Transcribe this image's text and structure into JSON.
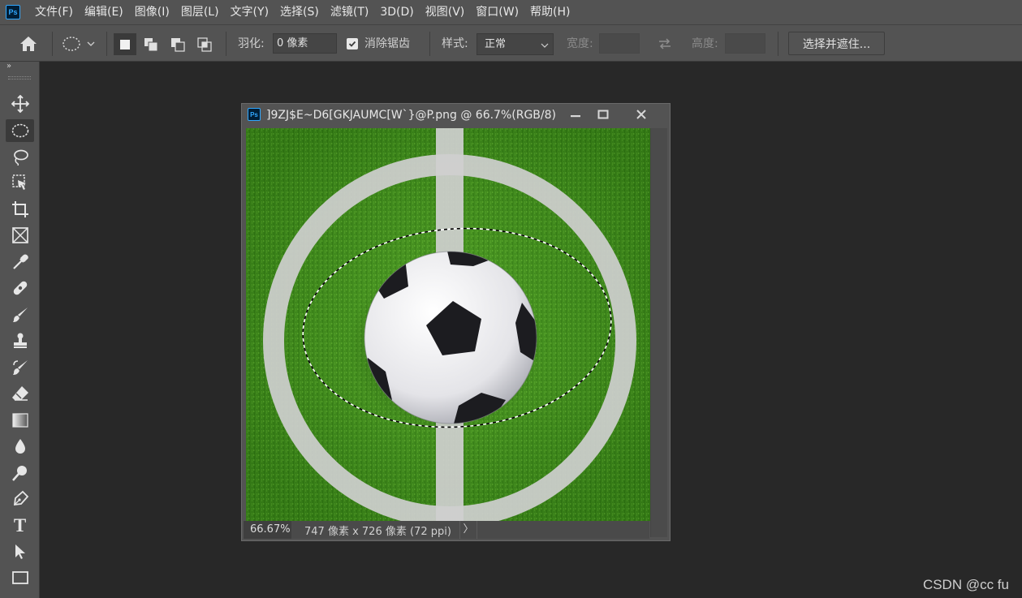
{
  "app": {
    "logo_text": "Ps"
  },
  "menu": [
    {
      "label": "文件(F)"
    },
    {
      "label": "编辑(E)"
    },
    {
      "label": "图像(I)"
    },
    {
      "label": "图层(L)"
    },
    {
      "label": "文字(Y)"
    },
    {
      "label": "选择(S)"
    },
    {
      "label": "滤镜(T)"
    },
    {
      "label": "3D(D)"
    },
    {
      "label": "视图(V)"
    },
    {
      "label": "窗口(W)"
    },
    {
      "label": "帮助(H)"
    }
  ],
  "options": {
    "feather_label": "羽化:",
    "feather_value": "0 像素",
    "antialias_label": "消除锯齿",
    "antialias_checked": true,
    "style_label": "样式:",
    "style_value": "正常",
    "width_label": "宽度:",
    "width_value": "",
    "height_label": "高度:",
    "height_value": "",
    "select_mask_button": "选择并遮住..."
  },
  "toolbar": {
    "collapse_glyph": "»",
    "tools": [
      {
        "name": "move-tool",
        "icon": "move-icon"
      },
      {
        "name": "elliptical-marquee-tool",
        "icon": "ellipse-marquee-icon",
        "active": true
      },
      {
        "name": "lasso-tool",
        "icon": "lasso-icon"
      },
      {
        "name": "object-selection-tool",
        "icon": "object-select-icon"
      },
      {
        "name": "crop-tool",
        "icon": "crop-icon"
      },
      {
        "name": "frame-tool",
        "icon": "frame-icon"
      },
      {
        "name": "eyedropper-tool",
        "icon": "eyedropper-icon"
      },
      {
        "name": "healing-brush-tool",
        "icon": "bandage-icon"
      },
      {
        "name": "brush-tool",
        "icon": "brush-icon"
      },
      {
        "name": "clone-stamp-tool",
        "icon": "stamp-icon"
      },
      {
        "name": "history-brush-tool",
        "icon": "history-brush-icon"
      },
      {
        "name": "eraser-tool",
        "icon": "eraser-icon"
      },
      {
        "name": "gradient-tool",
        "icon": "gradient-icon"
      },
      {
        "name": "blur-tool",
        "icon": "drop-icon"
      },
      {
        "name": "dodge-tool",
        "icon": "dodge-icon"
      },
      {
        "name": "pen-tool",
        "icon": "pen-icon"
      },
      {
        "name": "type-tool",
        "icon": "type-icon",
        "glyph": "T"
      },
      {
        "name": "path-selection-tool",
        "icon": "arrow-icon"
      },
      {
        "name": "rectangle-tool",
        "icon": "rectangle-icon"
      }
    ]
  },
  "document": {
    "logo_text": "Ps",
    "title": "]9ZJ$E~D6[GKJAUMC[W`}@P.png @ 66.7%(RGB/8)",
    "zoom": "66.67%",
    "dimensions": "747 像素 x 726 像素 (72 ppi)",
    "status_arrow": "〉"
  },
  "watermark": "CSDN @cc fu"
}
